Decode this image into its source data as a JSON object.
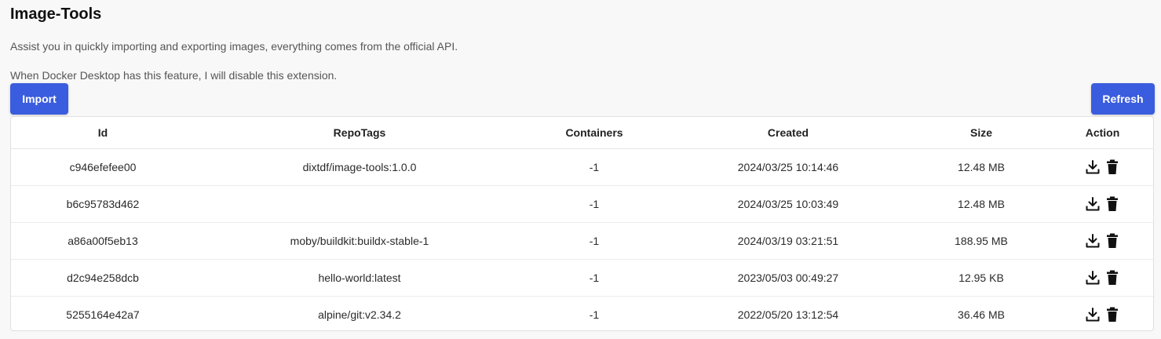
{
  "header": {
    "title": "Image-Tools",
    "description": "Assist you in quickly importing and exporting images, everything comes from the official API.",
    "notice": "When Docker Desktop has this feature, I will disable this extension."
  },
  "toolbar": {
    "import_label": "Import",
    "refresh_label": "Refresh"
  },
  "colors": {
    "accent": "#3a5cde",
    "background": "#f8f8f8"
  },
  "table": {
    "columns": [
      "Id",
      "RepoTags",
      "Containers",
      "Created",
      "Size",
      "Action"
    ],
    "rows": [
      {
        "id": "c946efefee00",
        "repotags": "dixtdf/image-tools:1.0.0",
        "containers": "-1",
        "created": "2024/03/25 10:14:46",
        "size": "12.48 MB"
      },
      {
        "id": "b6c95783d462",
        "repotags": "",
        "containers": "-1",
        "created": "2024/03/25 10:03:49",
        "size": "12.48 MB"
      },
      {
        "id": "a86a00f5eb13",
        "repotags": "moby/buildkit:buildx-stable-1",
        "containers": "-1",
        "created": "2024/03/19 03:21:51",
        "size": "188.95 MB"
      },
      {
        "id": "d2c94e258dcb",
        "repotags": "hello-world:latest",
        "containers": "-1",
        "created": "2023/05/03 00:49:27",
        "size": "12.95 KB"
      },
      {
        "id": "5255164e42a7",
        "repotags": "alpine/git:v2.34.2",
        "containers": "-1",
        "created": "2022/05/20 13:12:54",
        "size": "36.46 MB"
      }
    ],
    "row_actions": [
      "download-icon",
      "delete-icon"
    ]
  }
}
